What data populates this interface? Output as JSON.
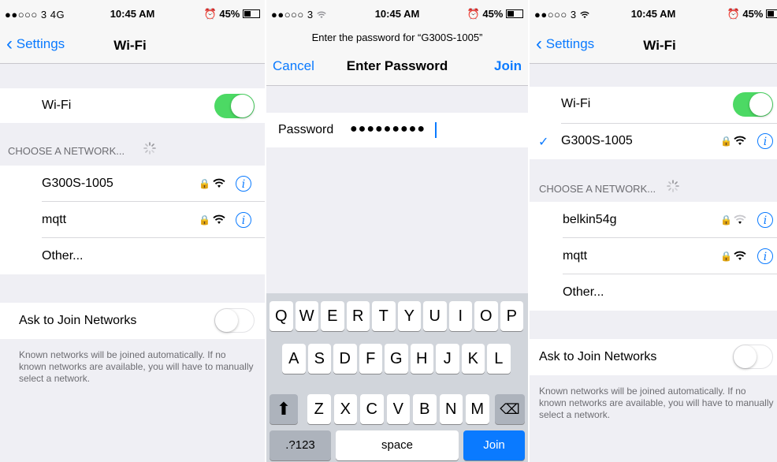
{
  "colors": {
    "accent": "#0a7aff",
    "toggle_on": "#4cd964",
    "background": "#efeff4"
  },
  "screen1": {
    "status": {
      "carrier": "●●○○○ 3  4G",
      "time": "10:45 AM",
      "battery": "⏰ 45%"
    },
    "nav": {
      "back": "Settings",
      "title": "Wi-Fi"
    },
    "wifi_row": {
      "label": "Wi-Fi",
      "toggle": "on"
    },
    "section_header": "CHOOSE A NETWORK...",
    "networks": [
      {
        "name": "G300S-1005",
        "locked": true,
        "signal": "strong"
      },
      {
        "name": "mqtt",
        "locked": true,
        "signal": "strong"
      },
      {
        "name": "Other..."
      }
    ],
    "ask_row": {
      "label": "Ask to Join Networks",
      "toggle": "off"
    },
    "footer": "Known networks will be joined automatically. If no known networks are available, you will have to manually select a network."
  },
  "screen2": {
    "status": {
      "carrier": "●●○○○ 3 ",
      "time": "10:45 AM",
      "battery": "⏰ 45%"
    },
    "prompt": "Enter the password for “G300S-1005”",
    "nav": {
      "cancel": "Cancel",
      "title": "Enter Password",
      "join": "Join"
    },
    "password": {
      "label": "Password",
      "value": "●●●●●●●●●"
    },
    "keyboard": {
      "row1": [
        "Q",
        "W",
        "E",
        "R",
        "T",
        "Y",
        "U",
        "I",
        "O",
        "P"
      ],
      "row2": [
        "A",
        "S",
        "D",
        "F",
        "G",
        "H",
        "J",
        "K",
        "L"
      ],
      "row3": [
        "Z",
        "X",
        "C",
        "V",
        "B",
        "N",
        "M"
      ],
      "shift": "⬆",
      "backspace": "⌫",
      "numbers": ".?123",
      "space": "space",
      "join": "Join"
    }
  },
  "screen3": {
    "status": {
      "carrier": "●●○○○ 3 ",
      "time": "10:45 AM",
      "battery": "⏰ 45%"
    },
    "nav": {
      "back": "Settings",
      "title": "Wi-Fi"
    },
    "wifi_row": {
      "label": "Wi-Fi",
      "toggle": "on"
    },
    "connected": {
      "check": "✓",
      "name": "G300S-1005"
    },
    "section_header": "CHOOSE A NETWORK...",
    "networks": [
      {
        "name": "belkin54g",
        "locked": true,
        "signal": "weak"
      },
      {
        "name": "mqtt",
        "locked": true,
        "signal": "strong"
      },
      {
        "name": "Other..."
      }
    ],
    "ask_row": {
      "label": "Ask to Join Networks",
      "toggle": "off"
    },
    "footer": "Known networks will be joined automatically. If no known networks are available, you will have to manually select a network."
  }
}
